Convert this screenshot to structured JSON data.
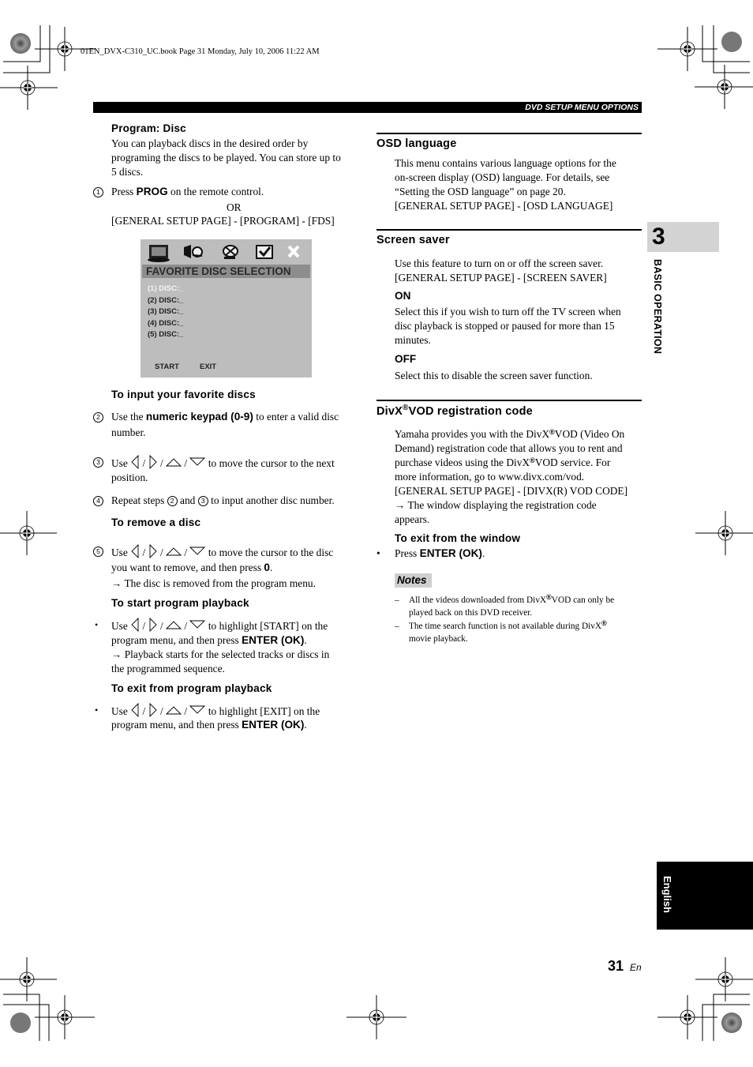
{
  "print_info": "01EN_DVX-C310_UC.book  Page 31  Monday, July 10, 2006  11:22 AM",
  "header": {
    "section_title": "DVD SETUP MENU OPTIONS"
  },
  "side_tabs": {
    "chapter_number": "3",
    "chapter_label": "BASIC OPERATION",
    "language_label": "English"
  },
  "footer": {
    "page_number": "31",
    "page_suffix": "En"
  },
  "left_column": {
    "program_disc": {
      "heading": "Program: Disc",
      "intro": [
        "You can playback discs in the desired order by",
        "programing the discs to be played. You can store up to",
        "5 discs."
      ],
      "step1": {
        "num": "1",
        "pre": "Press ",
        "key": "PROG",
        "post": " on the remote control."
      },
      "or": "OR",
      "menu_path": "[GENERAL SETUP PAGE] - [PROGRAM] - [FDS]"
    },
    "osd_screen": {
      "icons": [
        "tv-icon",
        "speaker-icon",
        "disc-icon",
        "check-icon",
        "close-icon"
      ],
      "title": "FAVORITE DISC SELECTION",
      "items": [
        "(1) DISC:_",
        "(2) DISC:_",
        "(3) DISC:_",
        "(4) DISC:_",
        "(5) DISC:_"
      ],
      "selected_index": 0,
      "start_label": "START",
      "exit_label": "EXIT"
    },
    "input_section": {
      "heading": "To input your favorite discs",
      "step2": {
        "num": "2",
        "pre": "Use the ",
        "key": "numeric keypad (0-9)",
        "post": " to enter a valid disc",
        "line2": "number."
      },
      "step3": {
        "num": "3",
        "pre": "Use",
        "post": "to move the cursor to the next",
        "line2": "position."
      },
      "step4": {
        "num": "4",
        "pre": "Repeat steps",
        "ref1": "2",
        "mid": "and",
        "ref2": "3",
        "post": "to input another disc number."
      }
    },
    "remove_section": {
      "heading": "To remove a disc",
      "step5": {
        "num": "5",
        "pre": "Use",
        "post": "to move the cursor to the disc",
        "line2_pre": "you want to remove, and then press ",
        "line2_key": "0",
        "line2_post": ".",
        "result": "→ The disc is removed from the program menu."
      }
    },
    "start_section": {
      "heading": "To start program playback",
      "pre": "Use",
      "post": "to highlight [START] on the",
      "line2_pre": "program menu, and then press ",
      "line2_key": "ENTER (OK)",
      "line2_post": ".",
      "result1": "→ Playback starts for the selected tracks or discs in",
      "result2": "the programmed sequence."
    },
    "exit_section": {
      "heading": "To exit from program playback",
      "pre": "Use",
      "post": "to highlight [EXIT] on the",
      "line2_pre": "program menu, and then press ",
      "line2_key": "ENTER (OK)",
      "line2_post": "."
    }
  },
  "right_column": {
    "osd_language": {
      "heading": "OSD language",
      "body": [
        "This menu contains various language options for the",
        "on-screen display (OSD) language. For details, see",
        "“Setting the OSD language” on page 20.",
        "[GENERAL SETUP PAGE] - [OSD LANGUAGE]"
      ]
    },
    "screen_saver": {
      "heading": "Screen saver",
      "body": [
        "Use this feature to turn on or off the screen saver.",
        "[GENERAL SETUP PAGE] - [SCREEN SAVER]"
      ],
      "on_label": "ON",
      "on_body": [
        "Select this if you wish to turn off the TV screen when",
        "disc playback is stopped or paused for more than 15",
        "minutes."
      ],
      "off_label": "OFF",
      "off_body": "Select this to disable the screen saver function."
    },
    "divx": {
      "heading_pre": "DivX",
      "heading_reg": "®",
      "heading_post": "VOD registration code",
      "l1_pre": "Yamaha provides you with the DivX",
      "l1_post": "VOD (Video On",
      "l2": "Demand) registration code that allows you to rent and",
      "l3_pre": "purchase videos using the DivX",
      "l3_post": "VOD service. For",
      "l4": "more information, go to www.divx.com/vod.",
      "l5": "[GENERAL SETUP PAGE] - [DIVX(R) VOD CODE]",
      "l6": "→ The window displaying the registration code",
      "l7": "appears.",
      "reg": "®"
    },
    "exit_window": {
      "heading": "To exit from the window",
      "pre": "Press ",
      "key": "ENTER (OK)",
      "post": "."
    },
    "notes": {
      "label": "Notes",
      "n1_l1_pre": "All the videos downloaded from DivX",
      "n1_l1_post": "VOD can only be",
      "n1_l2": "played back on this DVD receiver.",
      "n2_l1_pre": "The time search function is not available during DivX",
      "n2_l2": "movie playback.",
      "dash": "–",
      "reg": "®"
    }
  }
}
